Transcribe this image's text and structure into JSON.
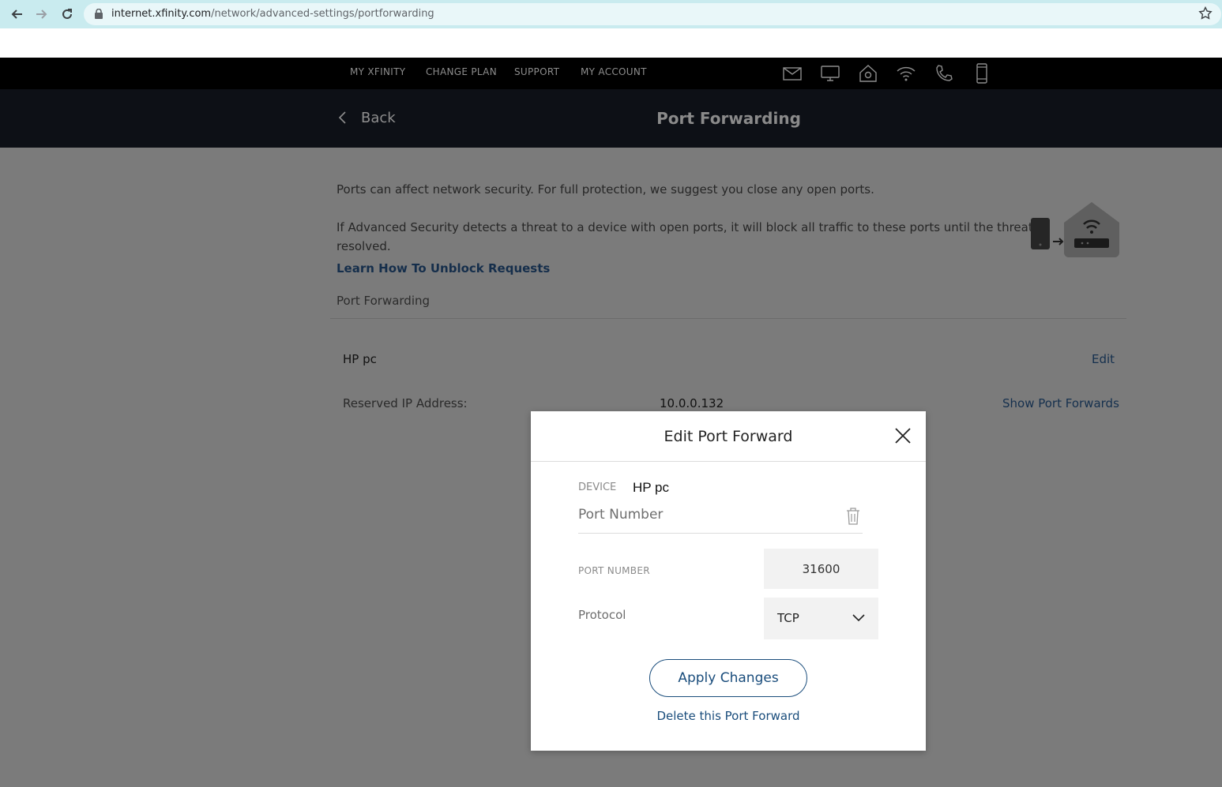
{
  "browser": {
    "url_host": "internet.xfinity.com",
    "url_path": "/network/advanced-settings/portforwarding",
    "icons": [
      "back-arrow-icon",
      "forward-arrow-icon",
      "reload-icon",
      "lock-icon",
      "star-icon"
    ]
  },
  "topnav": {
    "links": [
      "MY XFINITY",
      "CHANGE PLAN",
      "SUPPORT",
      "MY ACCOUNT"
    ],
    "icons": [
      "mail-icon",
      "tv-icon",
      "home-security-icon",
      "wifi-icon",
      "phone-icon",
      "mobile-icon"
    ]
  },
  "header": {
    "back_label": "Back",
    "title": "Port Forwarding"
  },
  "main": {
    "intro_1": "Ports can affect network security. For full protection, we suggest you close any open ports.",
    "intro_2_line1": "If Advanced Security detects a threat to a device with open ports, it will block all traffic to these ports until the threat is",
    "intro_2_line2": "resolved.",
    "learn_link": "Learn How To Unblock Requests",
    "section_label": "Port Forwarding",
    "device": {
      "name": "HP pc",
      "edit_label": "Edit",
      "ip_label": "Reserved IP Address:",
      "ip_value": "10.0.0.132",
      "show_label": "Show Port Forwards"
    }
  },
  "modal": {
    "title": "Edit Port Forward",
    "device_label": "DEVICE",
    "device_value": "HP pc",
    "port_heading": "Port Number",
    "port_label": "PORT NUMBER",
    "port_value": "31600",
    "protocol_label": "Protocol",
    "protocol_value": "TCP",
    "apply_label": "Apply Changes",
    "delete_label": "Delete this Port Forward"
  },
  "colors": {
    "overlay": "#7b7b7b",
    "header_bg": "#0d1016",
    "link": "#1a4d7c"
  }
}
